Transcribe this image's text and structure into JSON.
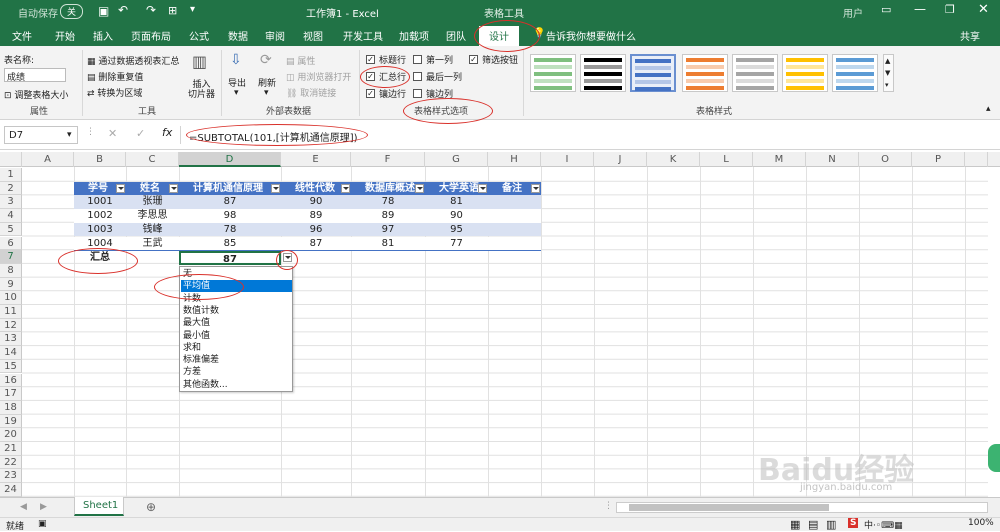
{
  "titlebar": {
    "autosave_label": "自动保存",
    "autosave_state": "关",
    "title": "工作簿1 - Excel",
    "context_label": "表格工具",
    "user_label": "用户"
  },
  "tabs": [
    "文件",
    "开始",
    "插入",
    "页面布局",
    "公式",
    "数据",
    "审阅",
    "视图",
    "开发工具",
    "加载项",
    "团队",
    "设计"
  ],
  "active_tab": "设计",
  "tell_me": "告诉我你想要做什么",
  "share": "共享",
  "ribbon": {
    "table_name_label": "表名称:",
    "table_name_value": "成绩",
    "resize_label": "调整表格大小",
    "group_properties": "属性",
    "pivot_label": "通过数据透视表汇总",
    "remove_dup_label": "删除重复值",
    "convert_label": "转换为区域",
    "slicer_label": "插入\n切片器",
    "group_tools": "工具",
    "export_label": "导出",
    "refresh_label": "刷新",
    "prop_label": "属性",
    "browser_label": "用浏览器打开",
    "unlink_label": "取消链接",
    "group_external": "外部表数据",
    "opt_header_row": "标题行",
    "opt_total_row": "汇总行",
    "opt_banded_rows": "镶边行",
    "opt_first_col": "第一列",
    "opt_last_col": "最后一列",
    "opt_banded_cols": "镶边列",
    "opt_filter_btn": "筛选按钮",
    "group_options": "表格样式选项",
    "group_styles": "表格样式"
  },
  "formula_bar": {
    "name_box": "D7",
    "formula": "=SUBTOTAL(101,[计算机通信原理])"
  },
  "columns": [
    "A",
    "B",
    "C",
    "D",
    "E",
    "F",
    "G",
    "H",
    "I",
    "J",
    "K",
    "L",
    "M",
    "N",
    "O",
    "P"
  ],
  "rows": [
    "1",
    "2",
    "3",
    "4",
    "5",
    "6",
    "7",
    "8",
    "9",
    "10",
    "11",
    "12",
    "13",
    "14",
    "15",
    "16",
    "17",
    "18",
    "19",
    "20",
    "21",
    "22",
    "23",
    "24"
  ],
  "table": {
    "headers": [
      "学号",
      "姓名",
      "计算机通信原理",
      "线性代数",
      "数据库概述",
      "大学英语",
      "备注"
    ],
    "rows": [
      [
        "1001",
        "张珊",
        "87",
        "90",
        "78",
        "81",
        ""
      ],
      [
        "1002",
        "李思思",
        "98",
        "89",
        "89",
        "90",
        ""
      ],
      [
        "1003",
        "钱峰",
        "78",
        "96",
        "97",
        "95",
        ""
      ],
      [
        "1004",
        "王武",
        "85",
        "87",
        "81",
        "77",
        ""
      ]
    ],
    "total_label": "汇总",
    "total_value": "87"
  },
  "dropdown_options": [
    "无",
    "平均值",
    "计数",
    "数值计数",
    "最大值",
    "最小值",
    "求和",
    "标准偏差",
    "方差",
    "其他函数..."
  ],
  "dropdown_selected": "平均值",
  "sheet_tab": "Sheet1",
  "status": {
    "ready": "就绪",
    "zoom": "100%"
  },
  "watermark": {
    "brand": "Baidu经验",
    "url": "jingyan.baidu.com"
  },
  "colors": {
    "excel_green": "#217346",
    "table_header": "#4472c4",
    "band_light": "#d9e1f2",
    "annotation_red": "#d9302a"
  }
}
